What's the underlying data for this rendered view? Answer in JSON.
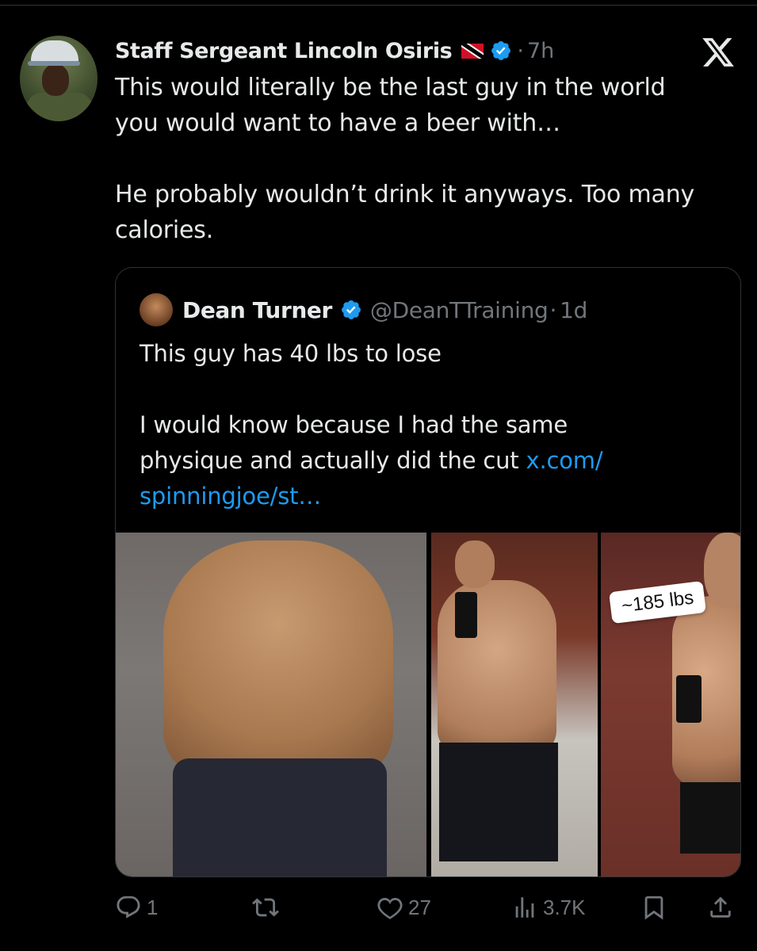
{
  "tweet": {
    "author_name": "Staff Sergeant Lincoln Osiris",
    "time": "7h",
    "separator": "·",
    "text_lines": [
      "This would literally be the last guy in the world",
      "you would want to have a beer with…",
      "",
      "He probably wouldn’t drink it anyways. Too many",
      "calories."
    ]
  },
  "quote": {
    "author_name": "Dean Turner",
    "handle": "@DeanTTraining",
    "time": "1d",
    "separator": "·",
    "line1": "This guy has 40 lbs to lose",
    "line2": "I would know because I had the same",
    "line3_text": "physique and actually did the cut ",
    "line3_link": "x.com/",
    "line4_link": "spinningjoe/st…",
    "photo_label": "~185 lbs"
  },
  "actions": {
    "reply_count": "1",
    "retweet_count": "",
    "like_count": "27",
    "views_count": "3.7K"
  },
  "icons": {
    "verified": "verified-badge-icon",
    "flag": "trinidad-flag-icon",
    "logo": "x-logo-icon",
    "reply": "reply-icon",
    "retweet": "retweet-icon",
    "like": "heart-icon",
    "views": "views-icon",
    "bookmark": "bookmark-icon",
    "share": "share-icon"
  },
  "colors": {
    "background": "#000000",
    "text": "#e7e9ea",
    "muted": "#71767b",
    "link": "#1d9bf0",
    "border": "#2f3336"
  }
}
